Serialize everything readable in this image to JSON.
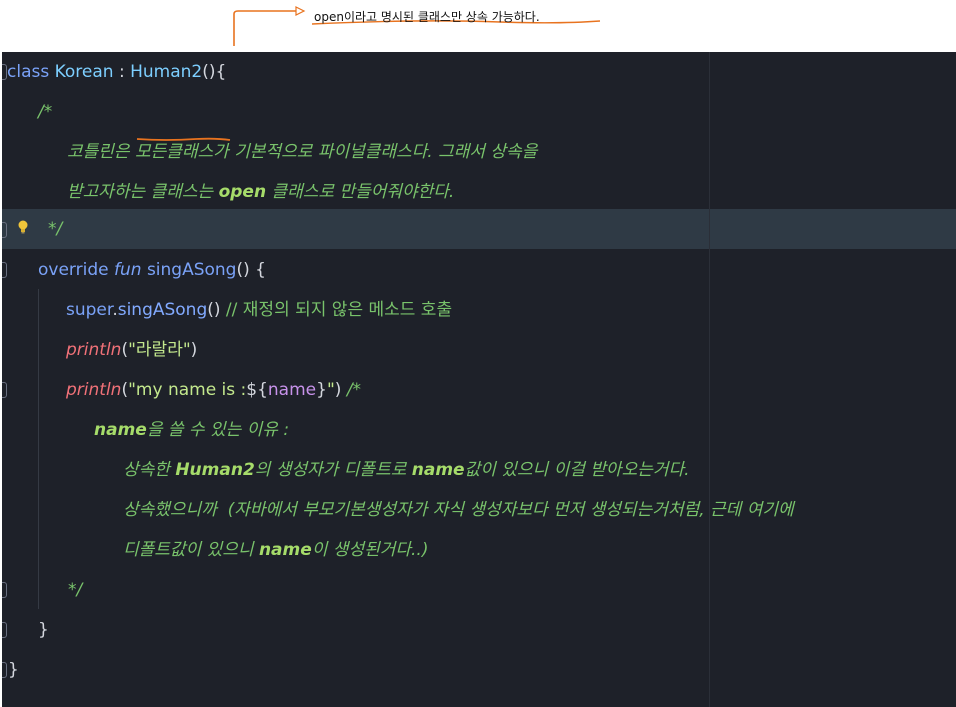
{
  "annotation": {
    "note_prefix": "open",
    "note_rest": "이라고 명시된 클래스만 상속 가능하다."
  },
  "code": {
    "line1": {
      "kw_class": "class",
      "class_name": "Korean",
      "colon": " : ",
      "super_name": "Human2",
      "tail": "(){"
    },
    "line2": {
      "comment": "/*"
    },
    "line3": {
      "comment": "코틀린은 모든클래스가 기본적으로 파이널클래스다. 그래서 상속을"
    },
    "line4": {
      "comment_a": "받고자하는 클래스는 ",
      "comment_strong": "open",
      "comment_b": " 클래스로 만들어줘야한다."
    },
    "line5": {
      "comment": "*/"
    },
    "line6": {
      "kw_override": "override",
      "kw_fun": "fun",
      "fn_name": "singASong",
      "tail": "() {"
    },
    "line7": {
      "kw_super": "super",
      "dot": ".",
      "call": "singASong",
      "parens": "()",
      "comment": " // 재정의 되지 않은 메소드 호출"
    },
    "line8": {
      "fn": "println",
      "open": "(",
      "str": "\"라랄라\"",
      "close": ")"
    },
    "line9": {
      "fn": "println",
      "open": "(",
      "str_a": "\"my name is :",
      "tmpl_open": "${",
      "tmpl_var": "name",
      "tmpl_close": "}",
      "str_b": "\"",
      "close": ") ",
      "comment": "/*"
    },
    "line10": {
      "strong": "name",
      "rest": "을 쓸 수 있는 이유 :"
    },
    "line11": {
      "a": "상속한 ",
      "strong1": "Human2",
      "b": "의 생성자가 디폴트로 ",
      "strong2": "name",
      "c": "값이 있으니 이걸 받아오는거다."
    },
    "line12": {
      "text": "상속했으니까  (자바에서 부모기본생성자가 자식 생성자보다 먼저 생성되는거처럼, 근데 여기에"
    },
    "line13": {
      "a": "디폴트값이 있으니 ",
      "strong": "name",
      "b": "이 생성된거다..)"
    },
    "line14": {
      "comment": "*/"
    },
    "line15": {
      "brace": "}"
    },
    "line16": {
      "brace": "}"
    }
  },
  "colors": {
    "editor_bg": "#1e2129",
    "highlight_line": "#2f3a45",
    "annotation_stroke": "#e8731f",
    "comment": "#79c36b",
    "keyword": "#7aa2f7",
    "println": "#f07178",
    "string": "#c3e88d"
  },
  "icons": {
    "gutter_hint": "lightbulb-icon",
    "annotation_arrow": "arrow-annotation-icon"
  }
}
